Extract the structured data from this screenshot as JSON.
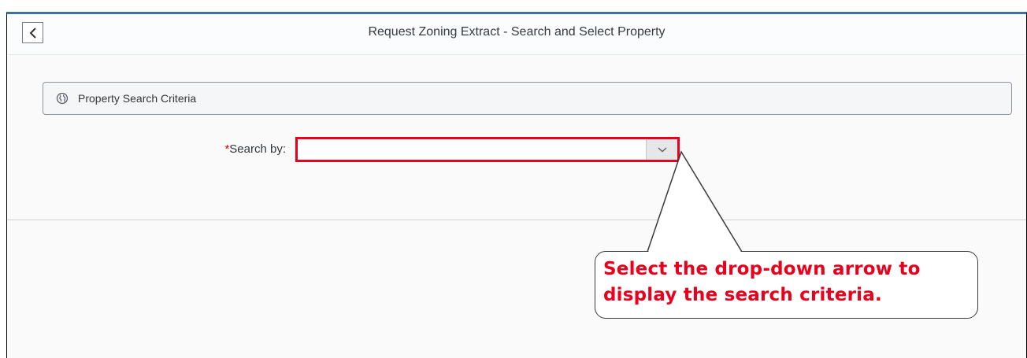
{
  "header": {
    "back_label": "<",
    "title": "Request Zoning Extract - Search and Select Property"
  },
  "section": {
    "icon": "globe-icon",
    "label": "Property Search Criteria"
  },
  "search": {
    "required_marker": "*",
    "label": "Search by:",
    "value": "",
    "dropdown_icon": "chevron-down-icon"
  },
  "callout": {
    "line1": "Select the drop-down arrow to",
    "line2": "display the search criteria."
  },
  "colors": {
    "accent": "#3f6fa5",
    "highlight": "#e8001c"
  }
}
